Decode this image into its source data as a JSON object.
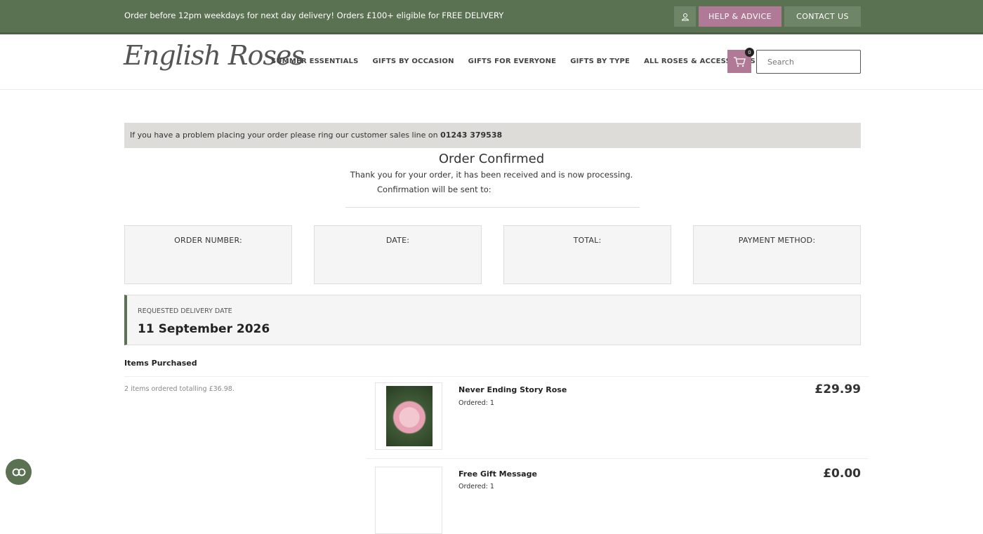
{
  "topbar": {
    "promo": "Order before 12pm weekdays for next day delivery! Orders £100+ eligible for FREE DELIVERY",
    "help": "HELP & ADVICE",
    "contact": "CONTACT US",
    "user_icon": "user-icon"
  },
  "header": {
    "logo": "English Roses",
    "nav": [
      "SUMMER ESSENTIALS",
      "GIFTS BY OCCASION",
      "GIFTS FOR EVERYONE",
      "GIFTS BY TYPE",
      "ALL ROSES & ACCESSORIES"
    ],
    "cart_count": "0",
    "search_placeholder": "Search",
    "cart_icon": "cart-icon"
  },
  "notice": {
    "text": "If you have a problem placing your order please ring our customer sales line on ",
    "phone": "01243 379538"
  },
  "confirmation": {
    "title": "Order Confirmed",
    "message": "Thank you for your order, it has been received and is now processing.",
    "sent_to": "Confirmation will be sent to:"
  },
  "order_info": {
    "number_label": "ORDER NUMBER:",
    "date_label": "DATE:",
    "total_label": "TOTAL:",
    "payment_label": "PAYMENT METHOD:"
  },
  "delivery": {
    "label": "REQUESTED DELIVERY DATE",
    "date": "11 September 2026"
  },
  "items": {
    "heading": "Items Purchased",
    "summary": "2 items ordered totalling £36.98.",
    "list": [
      {
        "name": "Never Ending Story Rose",
        "ordered": "Ordered: 1",
        "price": "£29.99"
      },
      {
        "name": "Free Gift Message",
        "ordered": "Ordered: 1",
        "price": "£0.00"
      }
    ]
  },
  "colors": {
    "primary_green": "#5a7252",
    "accent_pink": "#b07a96",
    "notice_bg": "#dedcd8"
  }
}
